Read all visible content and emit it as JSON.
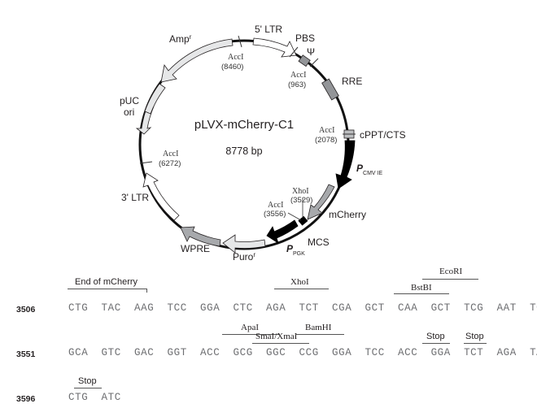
{
  "plasmid": {
    "name": "pLVX-mCherry-C1",
    "size": "8778 bp",
    "features": [
      {
        "key": "amp",
        "label": "Amp",
        "sup": "r"
      },
      {
        "key": "ltr5",
        "label": "5' LTR"
      },
      {
        "key": "pbs",
        "label": "PBS"
      },
      {
        "key": "psi",
        "label": "Ψ"
      },
      {
        "key": "rre",
        "label": "RRE"
      },
      {
        "key": "cppt",
        "label": "cPPT/CTS"
      },
      {
        "key": "pcmv",
        "label": "P",
        "sub": "CMV IE"
      },
      {
        "key": "mcherry",
        "label": "mCherry"
      },
      {
        "key": "mcs",
        "label": "MCS"
      },
      {
        "key": "ppgk",
        "label": "P",
        "sub": "PGK"
      },
      {
        "key": "puro",
        "label": "Puro",
        "sup": "r"
      },
      {
        "key": "wpre",
        "label": "WPRE"
      },
      {
        "key": "ltr3",
        "label": "3' LTR"
      },
      {
        "key": "puc",
        "label": "pUC",
        "label2": "ori"
      }
    ],
    "sites": [
      {
        "name": "AccI",
        "pos": "(8460)"
      },
      {
        "name": "AccI",
        "pos": "(963)"
      },
      {
        "name": "AccI",
        "pos": "(2078)"
      },
      {
        "name": "XhoI",
        "pos": "(3529)"
      },
      {
        "name": "AccI",
        "pos": "(3556)"
      },
      {
        "name": "AccI",
        "pos": "(6272)"
      }
    ]
  },
  "sequence": {
    "rows": [
      {
        "start": "3506",
        "codons": [
          "CTG",
          "TAC",
          "AAG",
          "TCC",
          "GGA",
          "CTC",
          "AGA",
          "TCT",
          "CGA",
          "GCT",
          "CAA",
          "GCT",
          "TCG",
          "AAT",
          "TCT"
        ],
        "annotations": [
          {
            "text": "End of mCherry"
          },
          {
            "text": "XhoI"
          },
          {
            "text": "BstBI"
          },
          {
            "text": "EcoRI"
          }
        ]
      },
      {
        "start": "3551",
        "codons": [
          "GCA",
          "GTC",
          "GAC",
          "GGT",
          "ACC",
          "GCG",
          "GGC",
          "CCG",
          "GGA",
          "TCC",
          "ACC",
          "GGA",
          "TCT",
          "AGA",
          "TAA"
        ],
        "annotations": [
          {
            "text": "ApaI"
          },
          {
            "text": "SmaI/XmaI"
          },
          {
            "text": "BamHI"
          },
          {
            "text": "Stop"
          },
          {
            "text": "Stop"
          }
        ]
      },
      {
        "start": "3596",
        "codons": [
          "CTG",
          "ATC"
        ],
        "annotations": [
          {
            "text": "Stop"
          }
        ]
      }
    ]
  }
}
